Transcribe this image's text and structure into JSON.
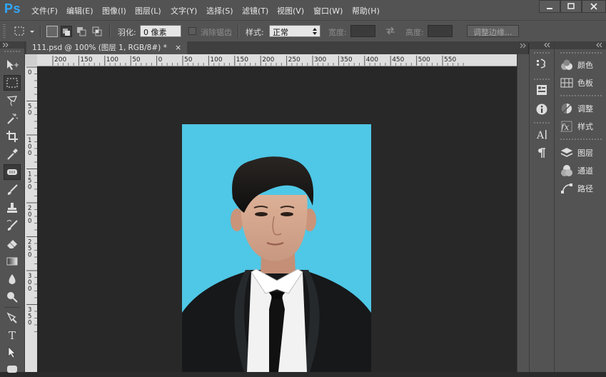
{
  "app": {
    "logo": "Ps"
  },
  "menu": [
    "文件(F)",
    "编辑(E)",
    "图像(I)",
    "图层(L)",
    "文字(Y)",
    "选择(S)",
    "滤镜(T)",
    "视图(V)",
    "窗口(W)",
    "帮助(H)"
  ],
  "options": {
    "feather_label": "羽化:",
    "feather_value": "0 像素",
    "antialias_label": "消除锯齿",
    "style_label": "样式:",
    "style_value": "正常",
    "width_label": "宽度:",
    "height_label": "高度:",
    "refine_edge": "调整边缘..."
  },
  "document": {
    "tab_title": "111.psd @ 100% (图层 1, RGB/8#) *",
    "close": "×",
    "ruler_top_ticks": [
      "200",
      "150",
      "100",
      "50",
      "0",
      "50",
      "100",
      "150",
      "200",
      "250",
      "300",
      "350",
      "400",
      "450",
      "500",
      "550"
    ],
    "ruler_left_ticks": [
      "0",
      "5 0",
      "1 0 0",
      "1 5 0",
      "2 0 0",
      "2 5 0",
      "3 0 0",
      "3 5 0"
    ]
  },
  "panels": {
    "dock1_icons": [
      "history-icon",
      "properties-icon",
      "info-icon",
      "character-icon",
      "paragraph-icon"
    ],
    "items": [
      {
        "label": "颜色",
        "icon": "color-icon"
      },
      {
        "label": "色板",
        "icon": "swatches-icon"
      },
      {
        "label": "调整",
        "icon": "adjustments-icon"
      },
      {
        "label": "样式",
        "icon": "styles-icon"
      },
      {
        "label": "图层",
        "icon": "layers-icon"
      },
      {
        "label": "通道",
        "icon": "channels-icon"
      },
      {
        "label": "路径",
        "icon": "paths-icon"
      }
    ]
  },
  "colors": {
    "canvas_bg": "#4fc7e6",
    "accent": "#31a8ff"
  }
}
